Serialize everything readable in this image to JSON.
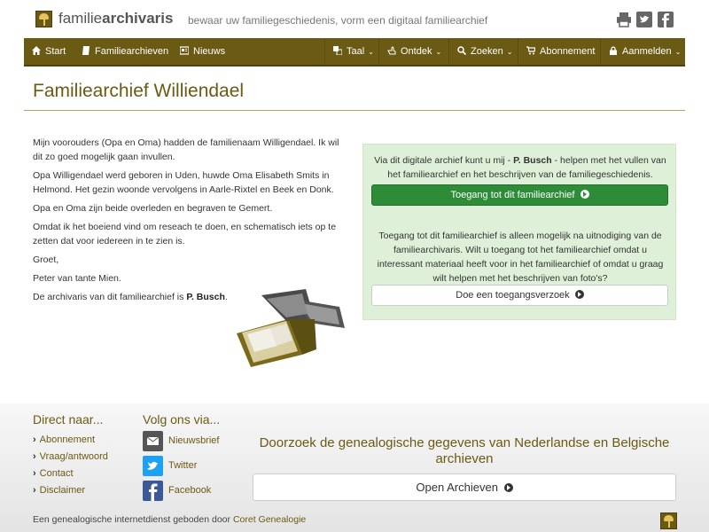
{
  "header": {
    "brand_prefix": "familie",
    "brand_bold": "archivaris",
    "tagline": "bewaar uw familiegeschiedenis, vorm een digitaal familiearchief",
    "share_icons": [
      "print-icon",
      "twitter-icon",
      "facebook-icon"
    ]
  },
  "nav": {
    "start": "Start",
    "familiearchieven": "Familiearchieven",
    "nieuws": "Nieuws",
    "taal": "Taal",
    "ontdek": "Ontdek",
    "zoeken": "Zoeken",
    "abonnement": "Abonnement",
    "aanmelden": "Aanmelden"
  },
  "page": {
    "title": "Familiearchief Williendael"
  },
  "story": {
    "p1": "Mijn voorouders (Opa en Oma) hadden de familienaam Willigendael. Ik wil dit zo goed mogelijk gaan invullen.",
    "p2": "Opa Willigendael werd geboren in Uden, huwde Oma Elisabeth Smits in Helmond. Het gezin woonde vervolgens in Aarle-Rixtel en Beek en Donk.",
    "p3": "Opa en Oma zijn beide overleden en begraven te Gemert.",
    "p4": "Omdat ik het boeiend vind om reseach te doen, en schematisch iets op te zetten dat voor iedereen in te zien is.",
    "p5": "Groet,",
    "p6": "Peter van tante Mien.",
    "p7_prefix": "De archivaris van dit familiearchief is ",
    "p7_name": "P. Busch",
    "p7_suffix": "."
  },
  "panel": {
    "intro_prefix": "Via dit digitale archief kunt u mij - ",
    "intro_name": "P. Busch",
    "intro_suffix": " - helpen met het vullen van het familiearchief en het beschrijven van de familiegeschiedenis.",
    "access_button": "Toegang tot dit familiearchief",
    "invite_text": "Toegang tot dit familiearchief is alleen mogelijk na uitnodiging van de familiearchivaris. Wilt u toegang tot het familiearchief omdat u interessant materiaal heeft voor in het familiearchief of omdat u graag wilt helpen met het beschrijven van foto's?",
    "request_button": "Doe een toegangsverzoek"
  },
  "footer": {
    "direct_heading": "Direct naar...",
    "direct_links": [
      "Abonnement",
      "Vraag/antwoord",
      "Contact",
      "Disclaimer"
    ],
    "follow_heading": "Volg ons via...",
    "follow_links": [
      "Nieuwsbrief",
      "Twitter",
      "Facebook"
    ],
    "search_title": "Doorzoek de genealogische gegevens van Nederlandse en Belgische archieven",
    "search_button": "Open Archieven",
    "credit_prefix": "Een genealogische internetdienst geboden door ",
    "credit_link": "Coret Genealogie"
  },
  "colors": {
    "brand": "#6b5a13",
    "panel_bg": "#dff0d8",
    "button_green": "#2e8b37"
  }
}
